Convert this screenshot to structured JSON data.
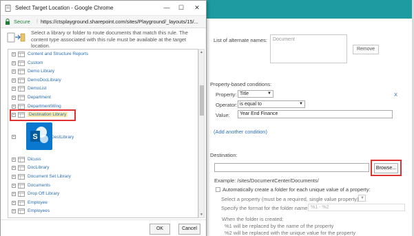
{
  "dialog": {
    "window_title": "Select Target Location - Google Chrome",
    "secure_label": "Secure",
    "url": "https://ctsplayground.sharepoint.com/sites/Playground/_layouts/15/...",
    "info_text": "Select a library or folder to route documents that match this rule. The content type associated with this rule must be available at the target location.",
    "tree_items": [
      {
        "label": "Content and Structure Reports"
      },
      {
        "label": "Custom"
      },
      {
        "label": "Demo Library"
      },
      {
        "label": "DemoDocLibrary"
      },
      {
        "label": "DemoList"
      },
      {
        "label": "Department"
      },
      {
        "label": "DepartmentWing"
      },
      {
        "label": "Destination Library",
        "selected": true
      },
      {
        "label": "DestLibrary"
      },
      {
        "label": "Dicuss"
      },
      {
        "label": "DocLibrary"
      },
      {
        "label": "Document Set Library"
      },
      {
        "label": "Documents"
      },
      {
        "label": "Drop Off Library"
      },
      {
        "label": "Employee"
      },
      {
        "label": "Employees"
      }
    ],
    "ok_label": "OK",
    "cancel_label": "Cancel"
  },
  "page": {
    "alt_names_label": "List of alternate names:",
    "alt_names_placeholder": "Document",
    "remove_label": "Remove",
    "prop_conditions_label": "Property-based conditions:",
    "property_label": "Property:",
    "property_value": "Title",
    "operator_label": "Operator:",
    "operator_value": "is equal to",
    "value_label": "Value:",
    "value_value": "Year End Finance",
    "remove_condition": "X",
    "add_condition": "(Add another condition)",
    "destination_label": "Destination:",
    "browse_label": "Browse...",
    "example_text": "Example: /sites/DocumentCenter/Documents/",
    "auto_folder_label": "Automatically create a folder for each unique value of a property:",
    "select_property_label": "Select a property (must be a required, single value property):",
    "format_label": "Specify the format for the folder name:",
    "format_value": "%1 - %2",
    "when_created": "When the folder is created:",
    "note1": "%1 will be replaced by the name of the property",
    "note2": "%2 will be replaced with the unique value for the property"
  },
  "colors": {
    "topbar": "#1e9ba0",
    "highlight": "#e03030",
    "link": "#2b6fb6"
  }
}
